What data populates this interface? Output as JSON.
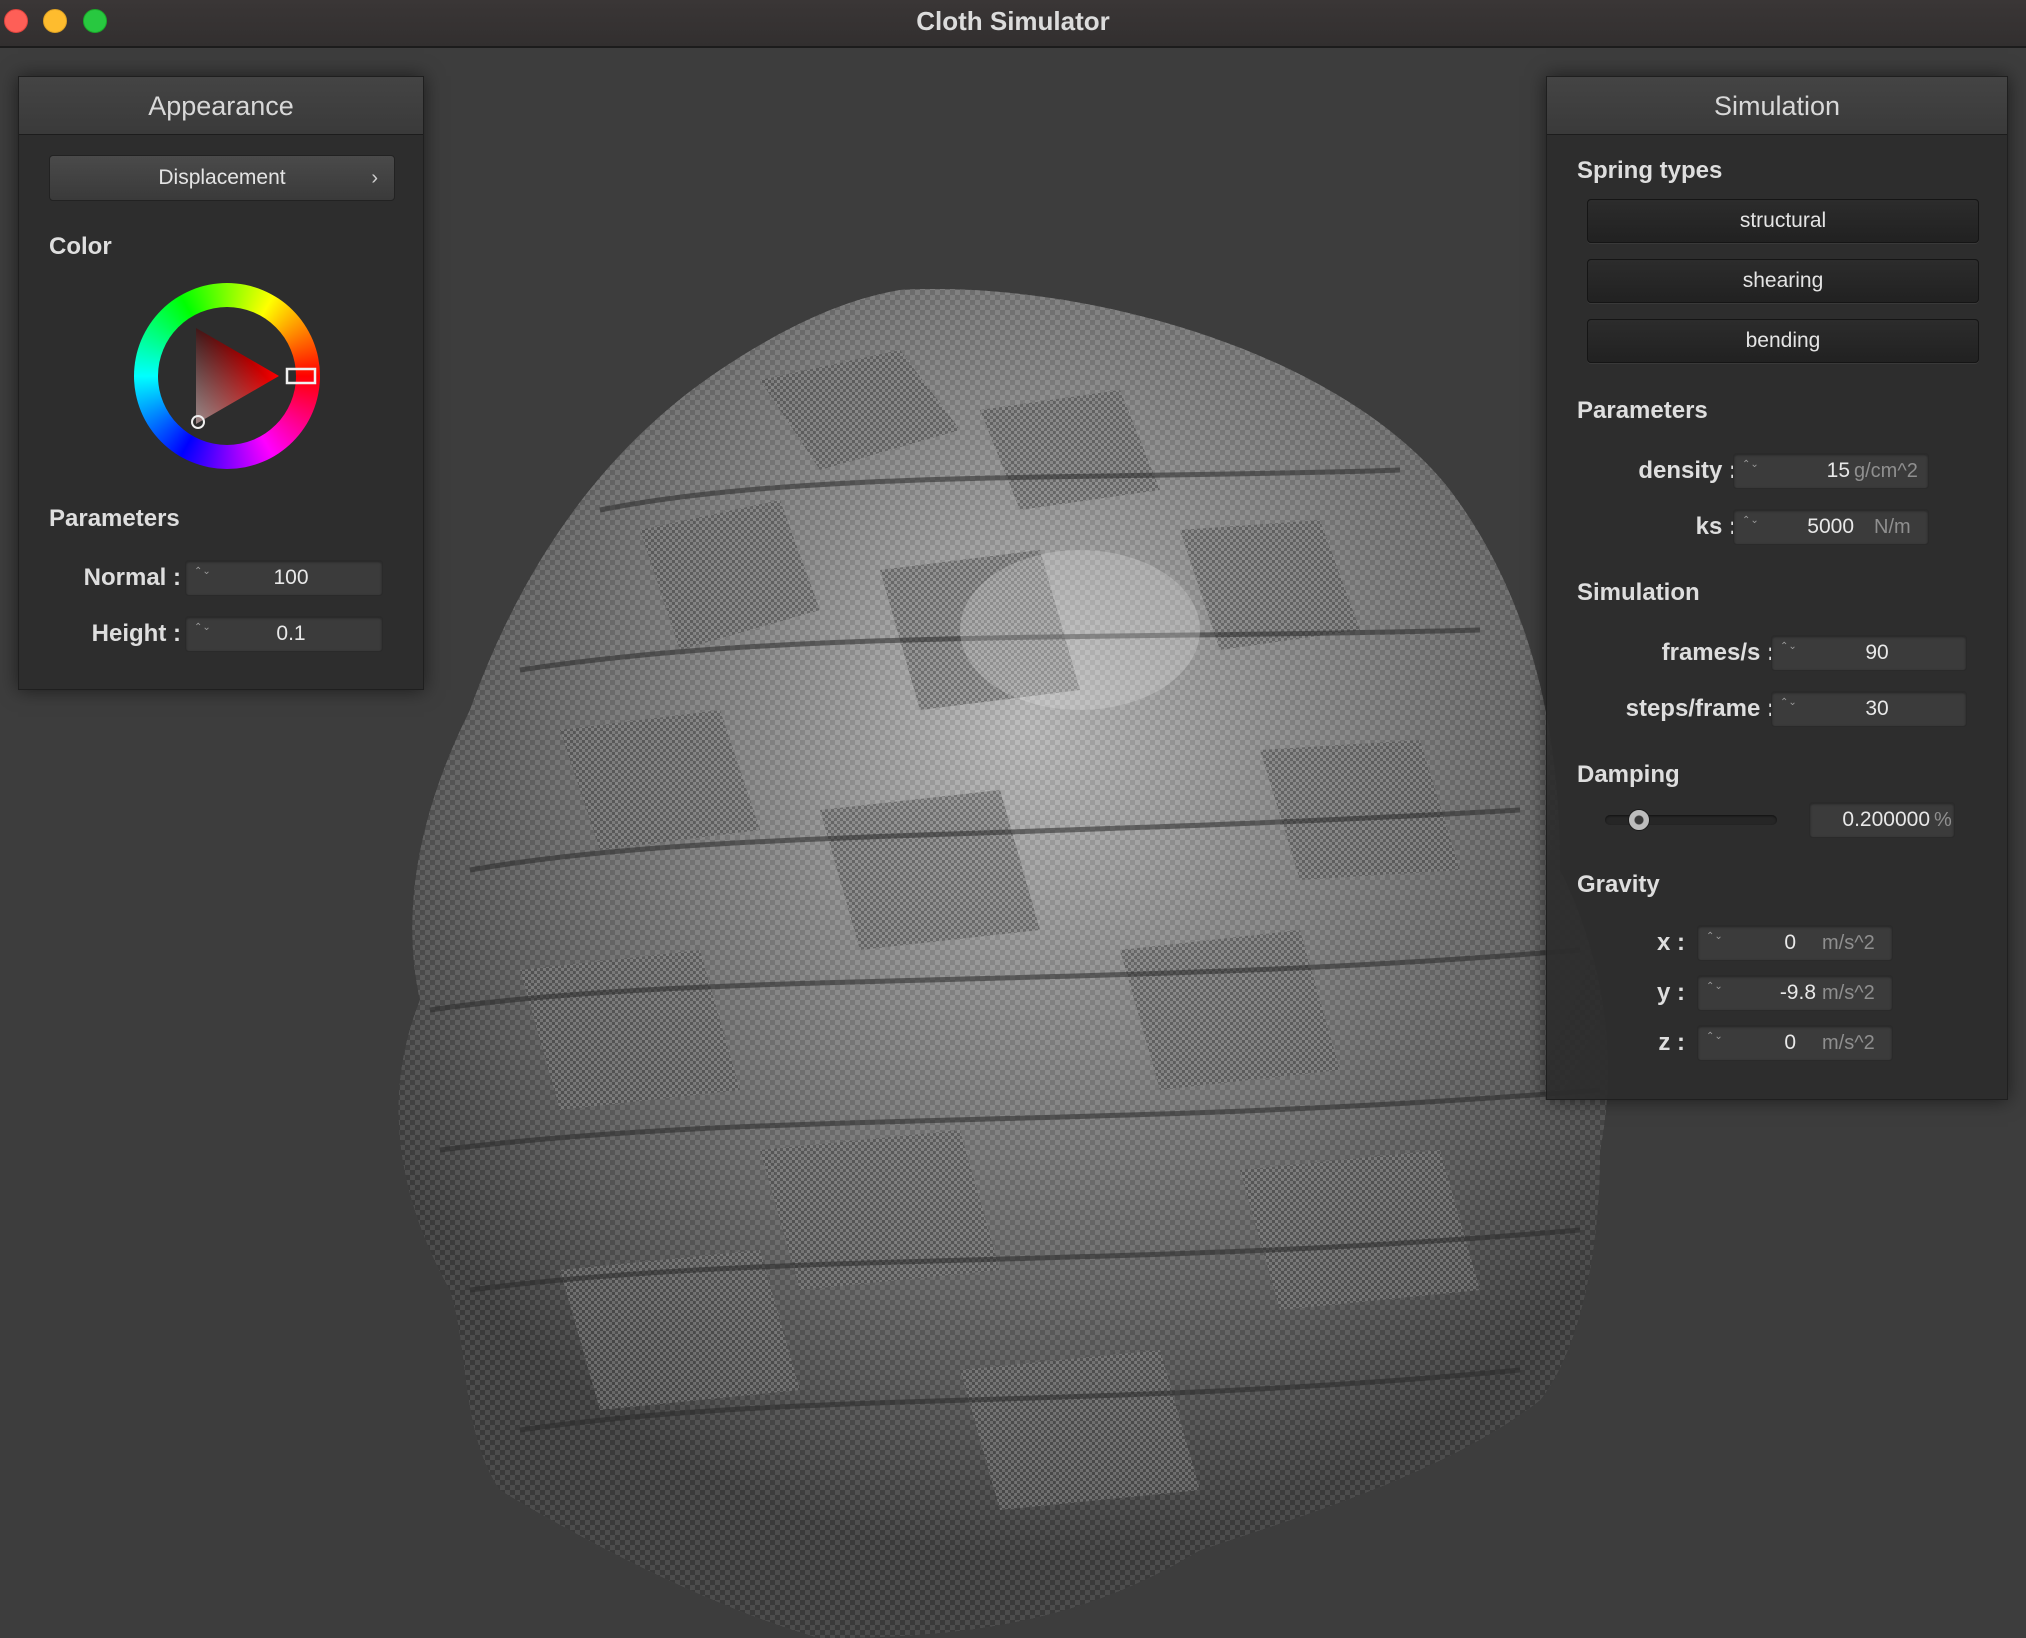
{
  "window": {
    "title": "Cloth Simulator"
  },
  "appearance": {
    "title": "Appearance",
    "shader_select": {
      "value": "Displacement",
      "chevron": "›"
    },
    "color_label": "Color",
    "color_wheel": {
      "selected_hue": "#ff0000"
    },
    "parameters_label": "Parameters",
    "normal": {
      "label": "Normal :",
      "value": "100"
    },
    "height": {
      "label": "Height :",
      "value": "0.1"
    }
  },
  "simulation": {
    "title": "Simulation",
    "spring_types_label": "Spring types",
    "spring_types": [
      "structural",
      "shearing",
      "bending"
    ],
    "parameters_label": "Parameters",
    "density": {
      "label": "density :",
      "value": "15",
      "unit": "g/cm^2"
    },
    "ks": {
      "label": "ks :",
      "value": "5000",
      "unit": "N/m"
    },
    "simulation_label": "Simulation",
    "fps": {
      "label": "frames/s :",
      "value": "90"
    },
    "steps": {
      "label": "steps/frame :",
      "value": "30"
    },
    "damping_label": "Damping",
    "damping": {
      "value": "0.200000",
      "unit": "%",
      "slider_fraction": 0.2
    },
    "gravity_label": "Gravity",
    "gravity": {
      "x": {
        "label": "x :",
        "value": "0",
        "unit": "m/s^2"
      },
      "y": {
        "label": "y :",
        "value": "-9.8",
        "unit": "m/s^2"
      },
      "z": {
        "label": "z :",
        "value": "0",
        "unit": "m/s^2"
      }
    }
  },
  "spinner_glyph": "⌃⌄"
}
